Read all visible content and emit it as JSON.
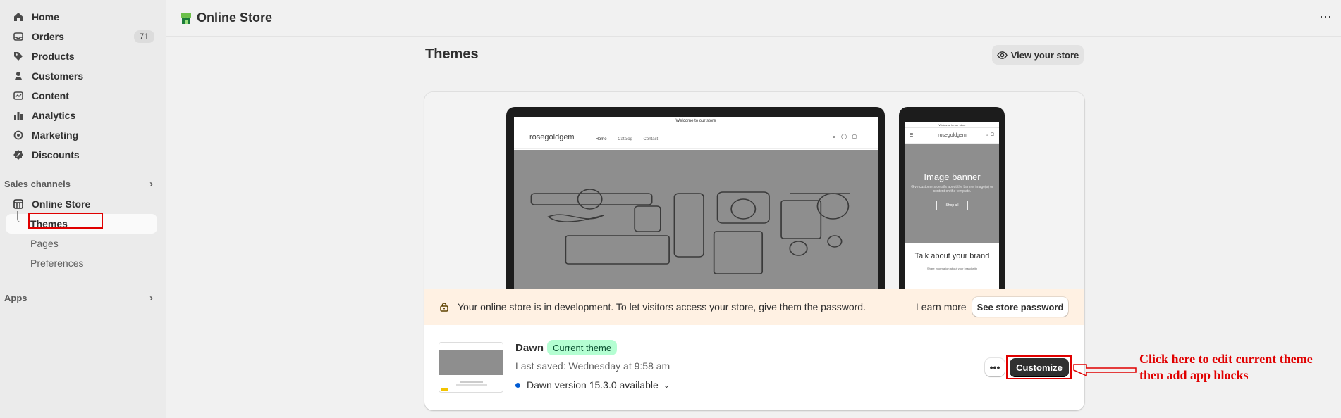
{
  "sidebar": {
    "items": [
      {
        "label": "Home",
        "icon": "home-icon"
      },
      {
        "label": "Orders",
        "icon": "inbox-icon",
        "badge": "71"
      },
      {
        "label": "Products",
        "icon": "tag-icon"
      },
      {
        "label": "Customers",
        "icon": "person-icon"
      },
      {
        "label": "Content",
        "icon": "content-icon"
      },
      {
        "label": "Analytics",
        "icon": "bar-chart-icon"
      },
      {
        "label": "Marketing",
        "icon": "target-icon"
      },
      {
        "label": "Discounts",
        "icon": "discount-icon"
      }
    ],
    "sales_channels_label": "Sales channels",
    "online_store_label": "Online Store",
    "sub_items": [
      "Themes",
      "Pages",
      "Preferences"
    ],
    "apps_label": "Apps"
  },
  "header": {
    "title": "Online Store",
    "more": "⋯"
  },
  "main": {
    "page_title": "Themes",
    "view_store_label": "View your store",
    "preview": {
      "announcement": "Welcome to our store",
      "brand": "rosegoldgem",
      "nav_links": [
        "Home",
        "Catalog",
        "Contact"
      ],
      "mobile_banner_title": "Image banner",
      "mobile_banner_text": "Give customers details about the banner image(s) or content on the template.",
      "mobile_button": "Shop all",
      "mobile_brand_heading": "Talk about your brand",
      "mobile_brand_text": "Share information about your brand with"
    },
    "banner": {
      "message": "Your online store is in development. To let visitors access your store, give them the password.",
      "learn_more": "Learn more",
      "button": "See store password"
    },
    "theme": {
      "name": "Dawn",
      "badge": "Current theme",
      "last_saved": "Last saved: Wednesday at 9:58 am",
      "version": "Dawn version 15.3.0 available",
      "more_label": "•••",
      "customize_label": "Customize"
    }
  },
  "annotation": {
    "text": "Click here to edit current theme then add app blocks",
    "color": "#e00000"
  }
}
